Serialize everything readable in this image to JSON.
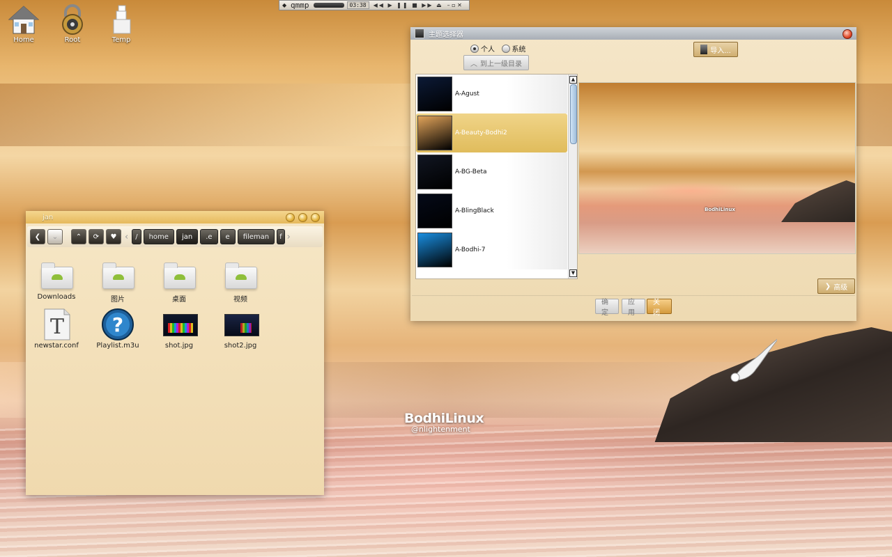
{
  "desktop": {
    "icons": [
      {
        "label": "Home",
        "icon": "house-icon"
      },
      {
        "label": "Root",
        "icon": "lock-icon"
      },
      {
        "label": "Temp",
        "icon": "stacked-box-icon"
      }
    ],
    "wallpaper_logo": {
      "line1": "BodhiLinux",
      "line2": "nlightenment"
    }
  },
  "qmmp": {
    "title": "qmmp",
    "time": "03:38",
    "controls": "◀◀ ▶ ❚❚ ■ ▶▶ ⏏"
  },
  "file_manager": {
    "title": "jan",
    "breadcrumbs": [
      "home",
      "jan",
      ".e",
      "e",
      "fileman"
    ],
    "current_crumb": "jan",
    "items": [
      {
        "name": "Downloads",
        "type": "folder"
      },
      {
        "name": "图片",
        "type": "folder"
      },
      {
        "name": "桌面",
        "type": "folder"
      },
      {
        "name": "视频",
        "type": "folder"
      },
      {
        "name": "newstar.conf",
        "type": "text"
      },
      {
        "name": "Playlist.m3u",
        "type": "playlist"
      },
      {
        "name": "shot.jpg",
        "type": "image"
      },
      {
        "name": "shot2.jpg",
        "type": "image"
      }
    ]
  },
  "theme_selector": {
    "title": "主题选择器",
    "radio_personal": "个人",
    "radio_system": "系统",
    "up_button": "到上一级目录",
    "import_button": "导入...",
    "themes": [
      {
        "name": "A-Agust",
        "selected": false,
        "thumb_color": "#0c1a36"
      },
      {
        "name": "A-Beauty-Bodhi2",
        "selected": true,
        "thumb_color": "#e2a45a"
      },
      {
        "name": "A-BG-Beta",
        "selected": false,
        "thumb_color": "#111622"
      },
      {
        "name": "A-BlingBlack",
        "selected": false,
        "thumb_color": "#050a18"
      },
      {
        "name": "A-Bodhi-7",
        "selected": false,
        "thumb_color": "#1a8ee0"
      }
    ],
    "preview_logo": "BodhiLinux",
    "advanced_button": "高级",
    "ok_button": "确定",
    "apply_button": "应用",
    "close_button": "关闭"
  }
}
